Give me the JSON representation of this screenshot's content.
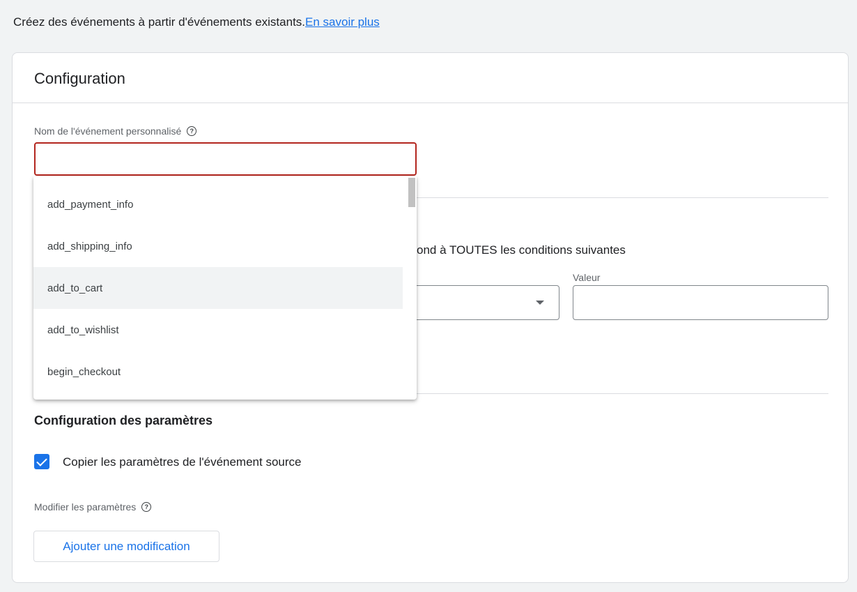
{
  "intro": {
    "text": "Créez des événements à partir d'événements existants.",
    "link": "En savoir plus"
  },
  "card": {
    "title": "Configuration",
    "name_field": {
      "label": "Nom de l'événement personnalisé",
      "value": "",
      "state": "error"
    },
    "condition_text": "ond à TOUTES les conditions suivantes",
    "value_label": "Valeur",
    "params": {
      "title": "Configuration des paramètres",
      "copy_checkbox": {
        "label": "Copier les paramètres de l'événement source",
        "checked": true
      },
      "modify_label": "Modifier les paramètres",
      "add_button": "Ajouter une modification"
    }
  },
  "dropdown": {
    "items": [
      "add_payment_info",
      "add_shipping_info",
      "add_to_cart",
      "add_to_wishlist",
      "begin_checkout"
    ],
    "hovered": "add_to_cart"
  },
  "colors": {
    "accent": "#1a73e8",
    "error": "#b3261e",
    "background": "#f1f3f4"
  },
  "icons": [
    "help-icon",
    "caret-down-icon",
    "check-icon"
  ]
}
